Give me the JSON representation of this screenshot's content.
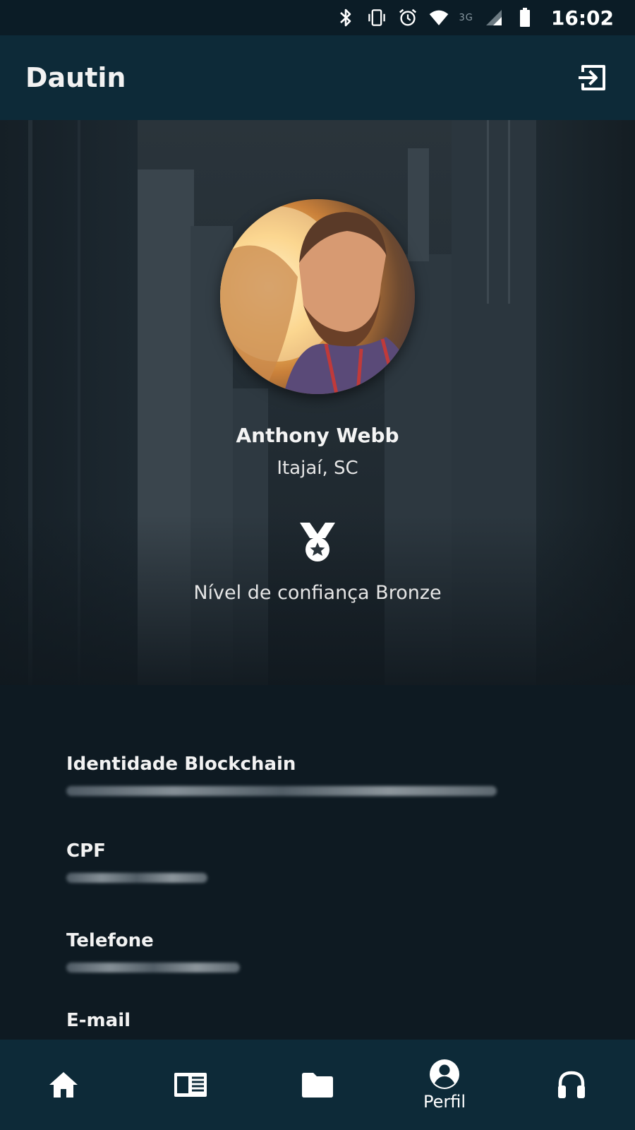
{
  "status_bar": {
    "network": "3G",
    "time": "16:02"
  },
  "app_bar": {
    "title": "Dautin"
  },
  "profile": {
    "name": "Anthony Webb",
    "location": "Itajaí, SC",
    "trust_level": "Nível de confiança Bronze"
  },
  "fields": [
    {
      "label": "Identidade Blockchain"
    },
    {
      "label": "CPF"
    },
    {
      "label": "Telefone"
    },
    {
      "label": "E-mail"
    }
  ],
  "bottom_nav": {
    "profile_label": "Perfil"
  },
  "colors": {
    "app_bar": "#0d2a38",
    "background": "#0e1a22",
    "status_bar": "#0b1c26"
  }
}
